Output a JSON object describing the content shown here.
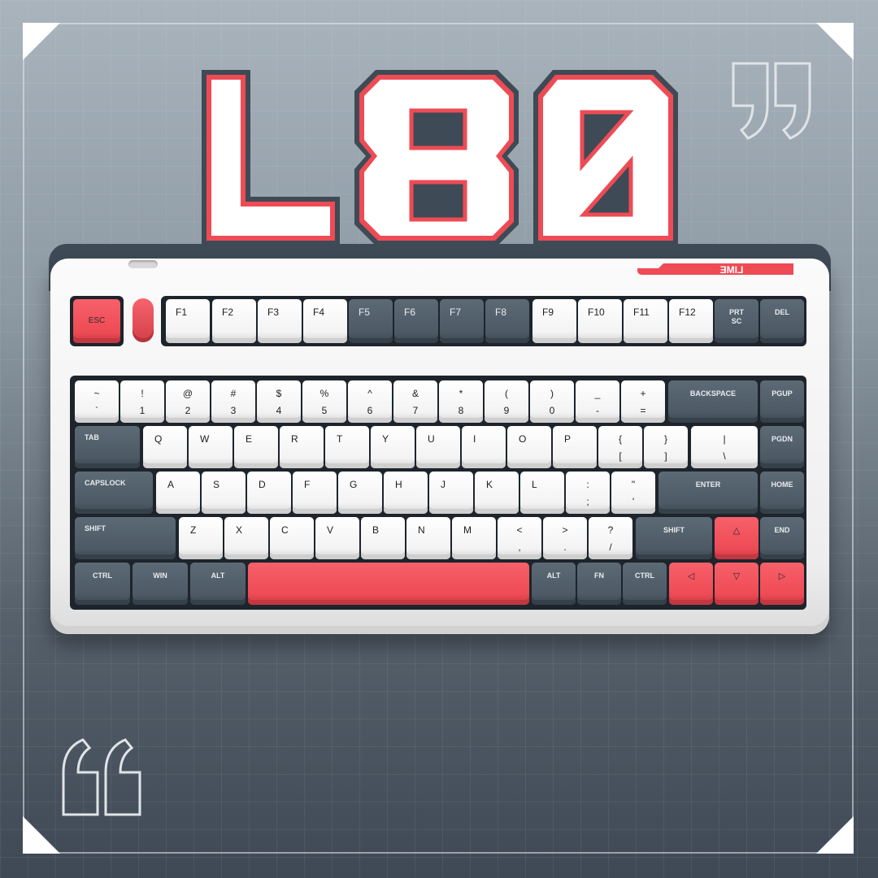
{
  "product": {
    "title": "L80",
    "brand_logo": "LIME"
  },
  "colors": {
    "accent_red": "#ee4b55",
    "dark_key": "#4d5a65",
    "light_key": "#f3f3f3",
    "background": "#8d99a3"
  },
  "decor": {
    "open_quote_icon": "open-quote-icon",
    "close_quote_icon": "close-quote-icon"
  },
  "keys": {
    "esc": "ESC",
    "f1": "F1",
    "f2": "F2",
    "f3": "F3",
    "f4": "F4",
    "f5": "F5",
    "f6": "F6",
    "f7": "F7",
    "f8": "F8",
    "f9": "F9",
    "f10": "F10",
    "f11": "F11",
    "f12": "F12",
    "prtsc_1": "PRT",
    "prtsc_2": "SC",
    "del": "DEL",
    "tilde_top": "~",
    "tilde_bot": "`",
    "n1_top": "!",
    "n1_bot": "1",
    "n2_top": "@",
    "n2_bot": "2",
    "n3_top": "#",
    "n3_bot": "3",
    "n4_top": "$",
    "n4_bot": "4",
    "n5_top": "%",
    "n5_bot": "5",
    "n6_top": "^",
    "n6_bot": "6",
    "n7_top": "&",
    "n7_bot": "7",
    "n8_top": "*",
    "n8_bot": "8",
    "n9_top": "(",
    "n9_bot": "9",
    "n0_top": ")",
    "n0_bot": "0",
    "minus_top": "_",
    "minus_bot": "-",
    "equal_top": "+",
    "equal_bot": "=",
    "backspace": "BACKSPACE",
    "pgup": "PGUP",
    "tab": "TAB",
    "q": "Q",
    "w": "W",
    "e": "E",
    "r": "R",
    "t": "T",
    "y": "Y",
    "u": "U",
    "i": "I",
    "o": "O",
    "p": "P",
    "lbracket_top": "{",
    "lbracket_bot": "[",
    "rbracket_top": "}",
    "rbracket_bot": "]",
    "backslash_top": "|",
    "backslash_bot": "\\",
    "pgdn": "PGDN",
    "capslock": "CAPSLOCK",
    "a": "A",
    "s": "S",
    "d": "D",
    "f": "F",
    "g": "G",
    "h": "H",
    "j": "J",
    "k": "K",
    "l": "L",
    "semicolon_top": ":",
    "semicolon_bot": ";",
    "quote_top": "\"",
    "quote_bot": "'",
    "enter": "ENTER",
    "home": "HOME",
    "lshift": "SHIFT",
    "z": "Z",
    "x": "X",
    "c": "C",
    "v": "V",
    "b": "B",
    "n": "N",
    "m": "M",
    "comma_top": "<",
    "comma_bot": ",",
    "period_top": ">",
    "period_bot": ".",
    "slash_top": "?",
    "slash_bot": "/",
    "rshift": "SHIFT",
    "up": "△",
    "end": "END",
    "lctrl": "CTRL",
    "win": "WIN",
    "lalt": "ALT",
    "ralt": "ALT",
    "fn": "FN",
    "rctrl": "CTRL",
    "left": "◁",
    "down": "▽",
    "right": "▷"
  }
}
